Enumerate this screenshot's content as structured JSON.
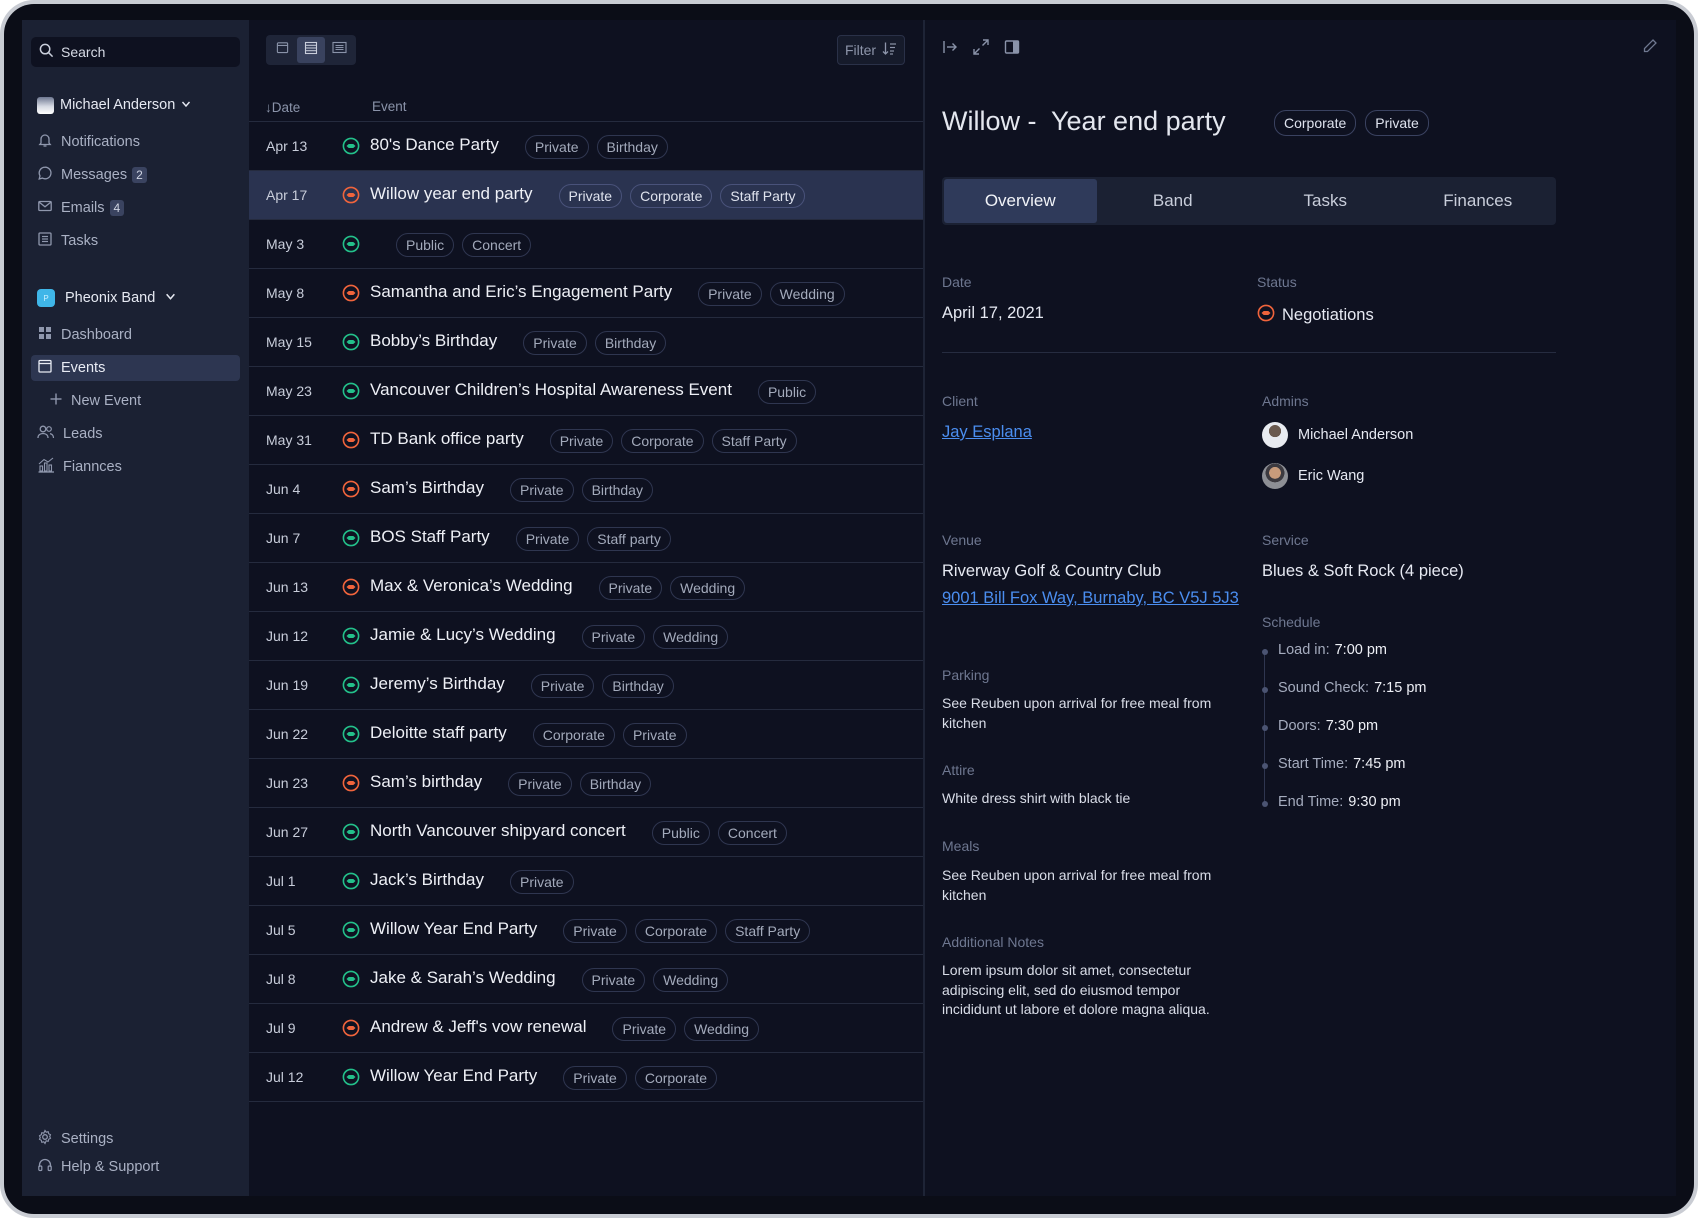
{
  "sidebar": {
    "search_placeholder": "Search",
    "user_name": "Michael Anderson",
    "top_items": [
      {
        "label": "Notifications",
        "icon": "bell-icon",
        "badge": ""
      },
      {
        "label": "Messages",
        "icon": "chat-icon",
        "badge": "2"
      },
      {
        "label": "Emails",
        "icon": "mail-icon",
        "badge": "4"
      },
      {
        "label": "Tasks",
        "icon": "tasks-icon",
        "badge": ""
      }
    ],
    "band_name": "Pheonix Band",
    "band_logo_text": "P",
    "band_items": [
      {
        "label": "Dashboard",
        "icon": "dashboard-icon"
      },
      {
        "label": "Events",
        "icon": "calendar-icon"
      },
      {
        "label": "New Event",
        "icon": "plus-icon"
      },
      {
        "label": "Leads",
        "icon": "users-icon"
      },
      {
        "label": "Fiannces",
        "icon": "chart-icon"
      }
    ],
    "bottom_items": [
      {
        "label": "Settings",
        "icon": "gear-icon"
      },
      {
        "label": "Help & Support",
        "icon": "headset-icon"
      }
    ]
  },
  "list": {
    "filter_label": "Filter",
    "header_date": "↓Date",
    "header_event": "Event",
    "status_colors": {
      "confirmed": "#23c08a",
      "negotiating": "#f0643c"
    },
    "rows": [
      {
        "date": "Apr 13",
        "status": "confirmed",
        "title": "80's Dance Party",
        "tags": [
          "Private",
          "Birthday"
        ]
      },
      {
        "date": "Apr 17",
        "status": "negotiating",
        "title": "Willow year end party",
        "tags": [
          "Private",
          "Corporate",
          "Staff Party"
        ],
        "selected": true
      },
      {
        "date": "May 3",
        "status": "confirmed",
        "title": "",
        "tags": [
          "Public",
          "Concert"
        ]
      },
      {
        "date": "May 8",
        "status": "negotiating",
        "title": "Samantha and Eric’s Engagement Party",
        "tags": [
          "Private",
          "Wedding"
        ]
      },
      {
        "date": "May 15",
        "status": "confirmed",
        "title": "Bobby’s Birthday",
        "tags": [
          "Private",
          "Birthday"
        ]
      },
      {
        "date": "May 23",
        "status": "confirmed",
        "title": "Vancouver Children’s Hospital Awareness Event",
        "tags": [
          "Public"
        ]
      },
      {
        "date": "May 31",
        "status": "negotiating",
        "title": "TD Bank office party",
        "tags": [
          "Private",
          "Corporate",
          "Staff Party"
        ]
      },
      {
        "date": "Jun 4",
        "status": "negotiating",
        "title": "Sam’s Birthday",
        "tags": [
          "Private",
          "Birthday"
        ]
      },
      {
        "date": "Jun 7",
        "status": "confirmed",
        "title": "BOS Staff Party",
        "tags": [
          "Private",
          "Staff party"
        ]
      },
      {
        "date": "Jun 13",
        "status": "negotiating",
        "title": "Max & Veronica’s Wedding",
        "tags": [
          "Private",
          "Wedding"
        ]
      },
      {
        "date": "Jun 12",
        "status": "confirmed",
        "title": "Jamie & Lucy’s Wedding",
        "tags": [
          "Private",
          "Wedding"
        ]
      },
      {
        "date": "Jun 19",
        "status": "confirmed",
        "title": "Jeremy’s Birthday",
        "tags": [
          "Private",
          "Birthday"
        ]
      },
      {
        "date": "Jun 22",
        "status": "confirmed",
        "title": "Deloitte staff party",
        "tags": [
          "Corporate",
          "Private"
        ]
      },
      {
        "date": "Jun 23",
        "status": "negotiating",
        "title": "Sam’s birthday",
        "tags": [
          "Private",
          "Birthday"
        ]
      },
      {
        "date": "Jun 27",
        "status": "confirmed",
        "title": "North Vancouver shipyard concert",
        "tags": [
          "Public",
          "Concert"
        ]
      },
      {
        "date": "Jul 1",
        "status": "confirmed",
        "title": "Jack’s Birthday",
        "tags": [
          "Private"
        ]
      },
      {
        "date": "Jul 5",
        "status": "confirmed",
        "title": "Willow Year End Party",
        "tags": [
          "Private",
          "Corporate",
          "Staff Party"
        ]
      },
      {
        "date": "Jul 8",
        "status": "confirmed",
        "title": "Jake & Sarah’s Wedding",
        "tags": [
          "Private",
          "Wedding"
        ]
      },
      {
        "date": "Jul 9",
        "status": "negotiating",
        "title": "Andrew & Jeff's vow renewal",
        "tags": [
          "Private",
          "Wedding"
        ]
      },
      {
        "date": "Jul 12",
        "status": "confirmed",
        "title": "Willow Year End Party",
        "tags": [
          "Private",
          "Corporate"
        ]
      }
    ]
  },
  "detail": {
    "title": "Willow -  Year end party",
    "tags": [
      "Corporate",
      "Private"
    ],
    "tabs": [
      "Overview",
      "Band",
      "Tasks",
      "Finances"
    ],
    "active_tab": "Overview",
    "date_label": "Date",
    "date_value": "April 17, 2021",
    "status_label": "Status",
    "status_value": "Negotiations",
    "client_label": "Client",
    "client_value": "Jay Esplana",
    "admins_label": "Admins",
    "admins": [
      "Michael Anderson",
      "Eric Wang"
    ],
    "venue_label": "Venue",
    "venue_name": "Riverway Golf & Country Club",
    "venue_address": "9001 Bill Fox Way, Burnaby, BC V5J 5J3",
    "service_label": "Service",
    "service_value": "Blues & Soft Rock (4 piece)",
    "schedule_label": "Schedule",
    "schedule": [
      {
        "label": "Load in:",
        "time": "7:00 pm"
      },
      {
        "label": "Sound Check:",
        "time": "7:15 pm"
      },
      {
        "label": "Doors:",
        "time": "7:30 pm"
      },
      {
        "label": "Start Time:",
        "time": "7:45 pm"
      },
      {
        "label": "End Time:",
        "time": "9:30 pm"
      }
    ],
    "parking_label": "Parking",
    "parking_value": "See Reuben upon arrival for free meal from kitchen",
    "attire_label": "Attire",
    "attire_value": "White dress shirt with black tie",
    "meals_label": "Meals",
    "meals_value": "See Reuben upon arrival for free meal from kitchen",
    "notes_label": "Additional Notes",
    "notes_value": "Lorem ipsum dolor sit amet, consectetur adipiscing elit, sed do eiusmod tempor incididunt ut labore et dolore magna aliqua."
  }
}
